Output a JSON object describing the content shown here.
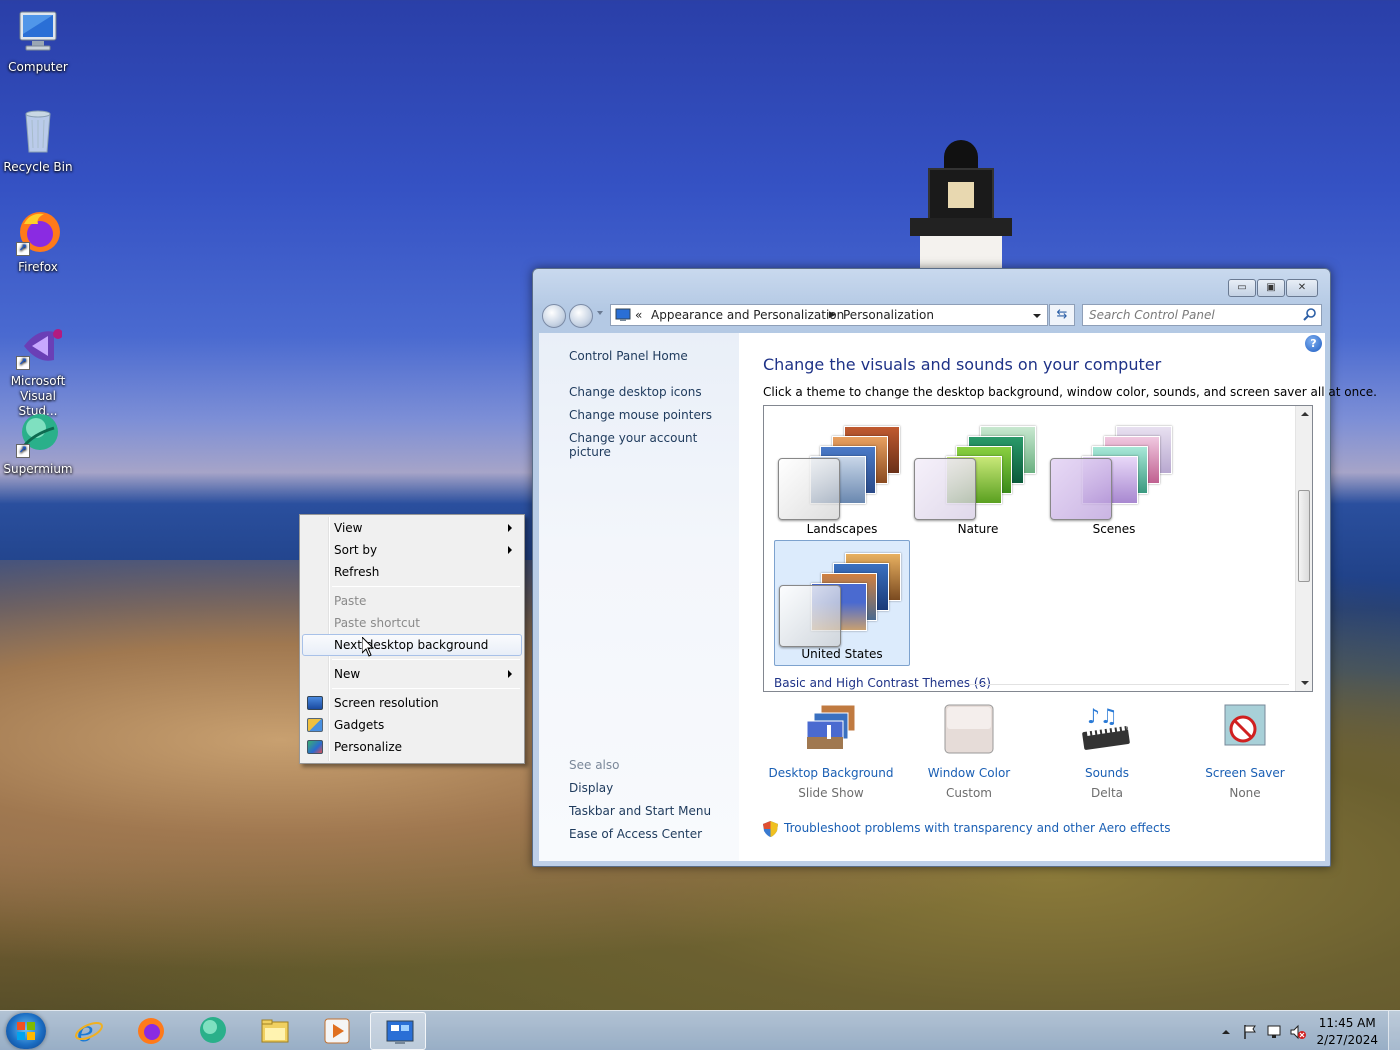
{
  "desktop": {
    "icons": [
      {
        "label": "Computer"
      },
      {
        "label": "Recycle Bin"
      },
      {
        "label": "Firefox"
      },
      {
        "label": "Microsoft Visual Stud..."
      },
      {
        "label": "Supermium"
      }
    ]
  },
  "context_menu": {
    "view": "View",
    "sort_by": "Sort by",
    "refresh": "Refresh",
    "paste": "Paste",
    "paste_shortcut": "Paste shortcut",
    "next_background": "Next desktop background",
    "new": "New",
    "screen_resolution": "Screen resolution",
    "gadgets": "Gadgets",
    "personalize": "Personalize"
  },
  "window": {
    "address": {
      "root_chevron": "«",
      "crumb1": "Appearance and Personalization",
      "crumb2": "Personalization"
    },
    "search": {
      "placeholder": "Search Control Panel"
    },
    "left_pane": {
      "home": "Control Panel Home",
      "links": [
        "Change desktop icons",
        "Change mouse pointers",
        "Change your account picture"
      ],
      "see_also_header": "See also",
      "see_also": [
        "Display",
        "Taskbar and Start Menu",
        "Ease of Access Center"
      ]
    },
    "main": {
      "title": "Change the visuals and sounds on your computer",
      "subtitle": "Click a theme to change the desktop background, window color, sounds, and screen saver all at once.",
      "themes": [
        {
          "name": "Landscapes"
        },
        {
          "name": "Nature"
        },
        {
          "name": "Scenes"
        },
        {
          "name": "United States",
          "selected": true
        }
      ],
      "group_header": "Basic and High Contrast Themes (6)",
      "options": [
        {
          "label": "Desktop Background",
          "value": "Slide Show"
        },
        {
          "label": "Window Color",
          "value": "Custom"
        },
        {
          "label": "Sounds",
          "value": "Delta"
        },
        {
          "label": "Screen Saver",
          "value": "None"
        }
      ],
      "troubleshoot": "Troubleshoot problems with transparency and other Aero effects"
    }
  },
  "taskbar": {
    "clock": {
      "time": "11:45 AM",
      "date": "2/27/2024"
    }
  },
  "colors": {
    "link": "#1a5fb4",
    "title": "#1e3287",
    "menu_hover": "#dbe7f8"
  }
}
